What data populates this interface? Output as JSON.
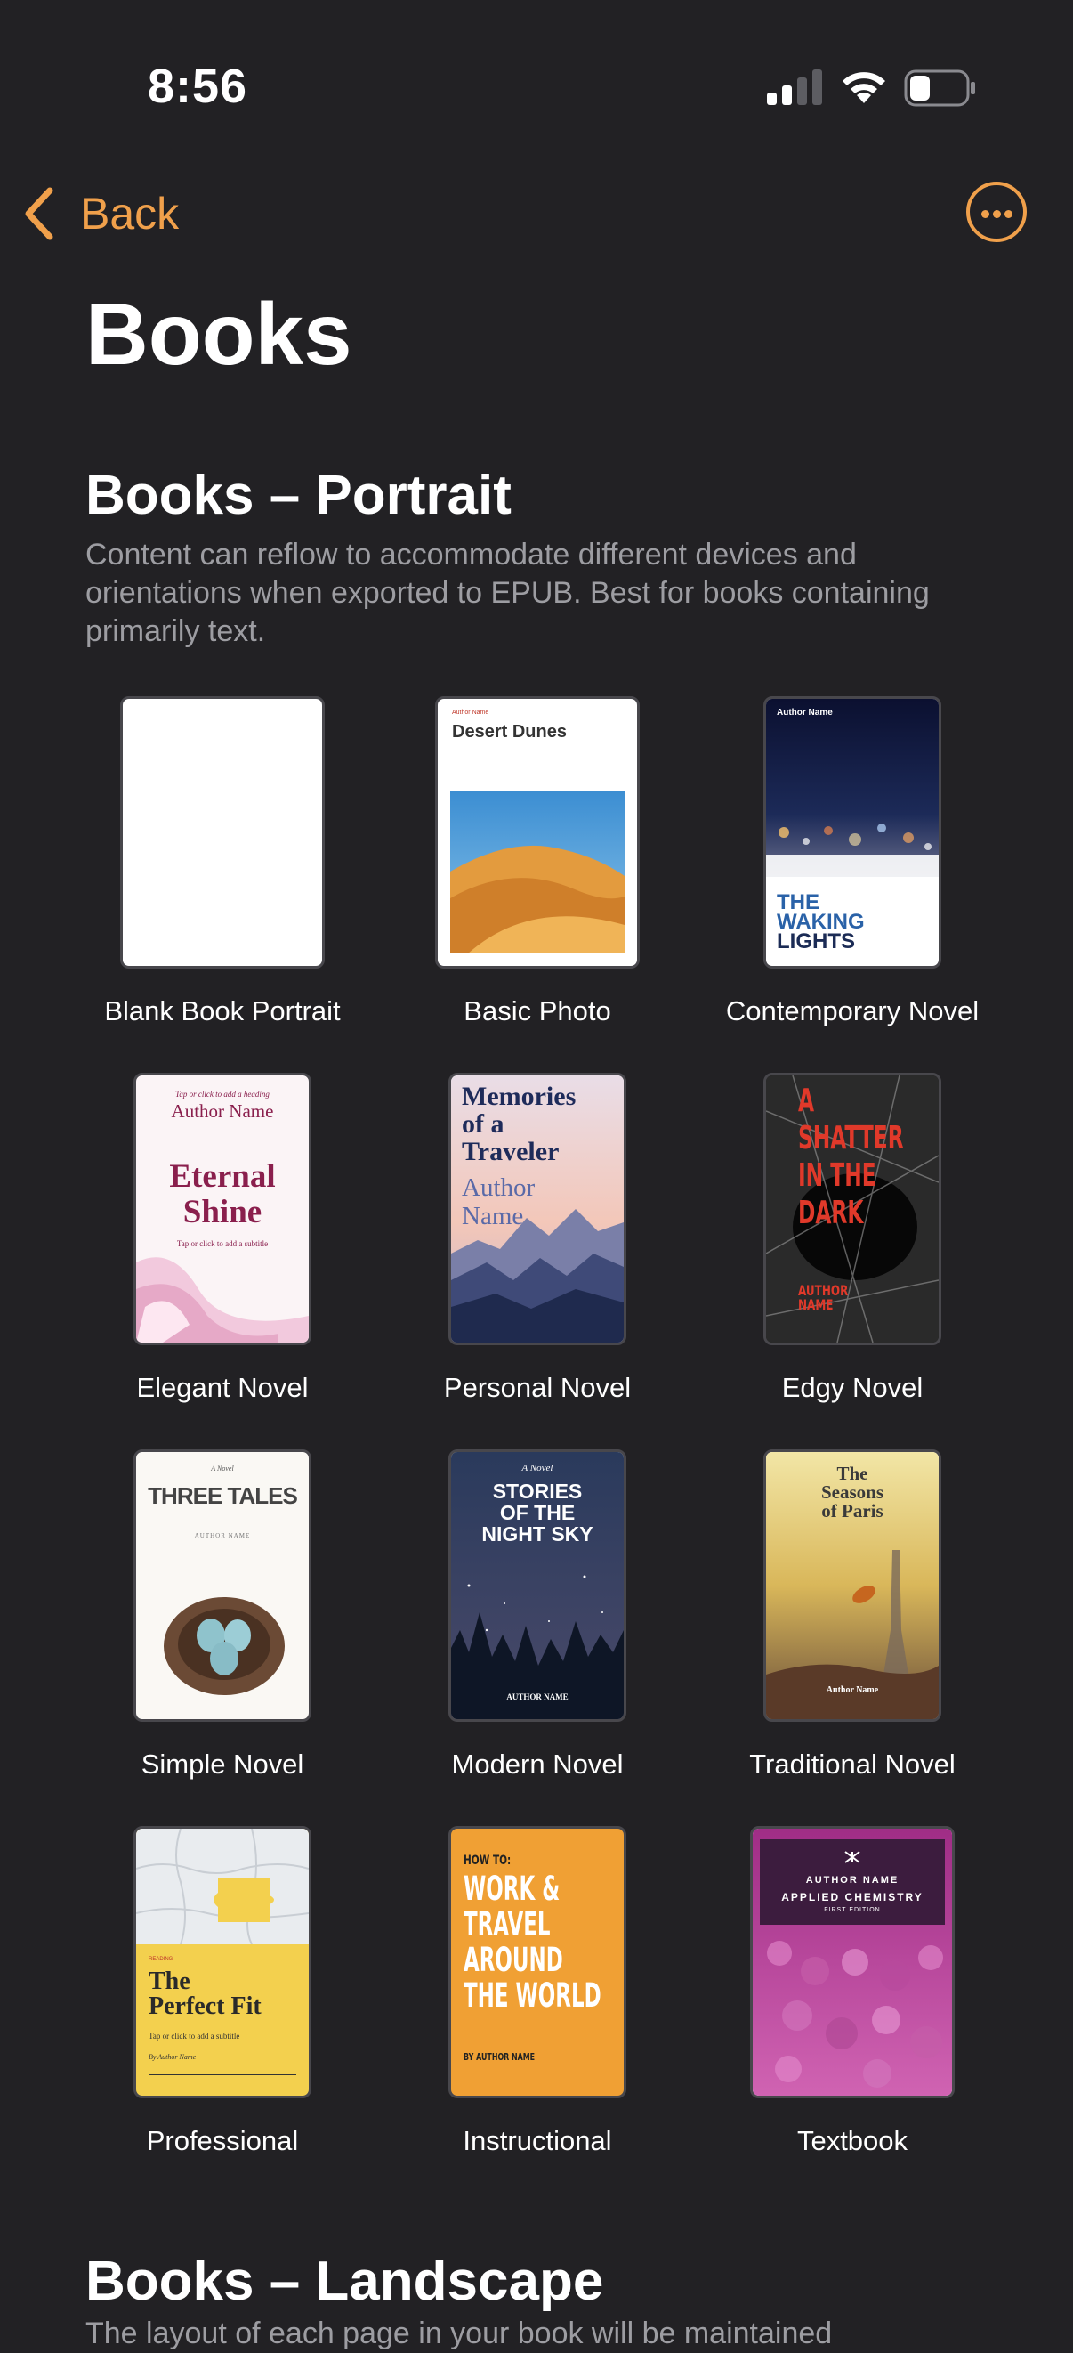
{
  "status_bar": {
    "time": "8:56",
    "signal_icon": "cellular-signal-icon",
    "wifi_icon": "wifi-icon",
    "battery_icon": "battery-icon"
  },
  "nav": {
    "back_label": "Back",
    "more_icon": "ellipsis-circle-icon",
    "accent": "#f0a04b"
  },
  "page_title": "Books",
  "section_portrait": {
    "title": "Books – Portrait",
    "description": "Content can reflow to accommodate different devices and orientations when exported to EPUB. Best for books containing primarily text."
  },
  "templates": [
    {
      "label": "Blank Book Portrait"
    },
    {
      "label": "Basic Photo",
      "cover": {
        "author": "Author Name",
        "title": "Desert Dunes"
      }
    },
    {
      "label": "Contemporary Novel",
      "cover": {
        "author": "Author Name",
        "title_lines": [
          "THE",
          "WAKING",
          "LIGHTS"
        ]
      }
    },
    {
      "label": "Elegant Novel",
      "cover": {
        "heading_hint": "Tap or click to add a heading",
        "author": "Author Name",
        "title_lines": [
          "Eternal",
          "Shine"
        ],
        "subtitle_hint": "Tap or click to add a subtitle"
      }
    },
    {
      "label": "Personal Novel",
      "cover": {
        "title_lines": [
          "Memories",
          "of a",
          "Traveler"
        ],
        "author_lines": [
          "Author",
          "Name"
        ]
      }
    },
    {
      "label": "Edgy Novel",
      "cover": {
        "title_lines": [
          "A",
          "SHATTER",
          "IN THE",
          "DARK"
        ],
        "author_lines": [
          "AUTHOR",
          "NAME"
        ]
      }
    },
    {
      "label": "Simple Novel",
      "cover": {
        "kicker": "A Novel",
        "title": "THREE TALES",
        "author": "AUTHOR NAME"
      }
    },
    {
      "label": "Modern Novel",
      "cover": {
        "kicker": "A Novel",
        "title_lines": [
          "STORIES",
          "OF THE",
          "NIGHT SKY"
        ],
        "author": "AUTHOR NAME"
      }
    },
    {
      "label": "Traditional Novel",
      "cover": {
        "title_lines": [
          "The",
          "Seasons",
          "of Paris"
        ],
        "author": "Author Name"
      }
    },
    {
      "label": "Professional",
      "cover": {
        "kicker": "READING",
        "title_lines": [
          "The",
          "Perfect Fit"
        ],
        "subtitle_hint": "Tap or click to add a subtitle",
        "author": "By Author Name"
      }
    },
    {
      "label": "Instructional",
      "cover": {
        "kicker": "HOW TO:",
        "title_lines": [
          "WORK &",
          "TRAVEL",
          "AROUND",
          "THE WORLD"
        ],
        "author": "BY AUTHOR NAME"
      }
    },
    {
      "label": "Textbook",
      "cover": {
        "author": "AUTHOR NAME",
        "title": "APPLIED CHEMISTRY",
        "edition": "FIRST EDITION"
      }
    }
  ],
  "section_landscape": {
    "title": "Books – Landscape",
    "description_partial": "The layout of each page in your book will be maintained"
  }
}
